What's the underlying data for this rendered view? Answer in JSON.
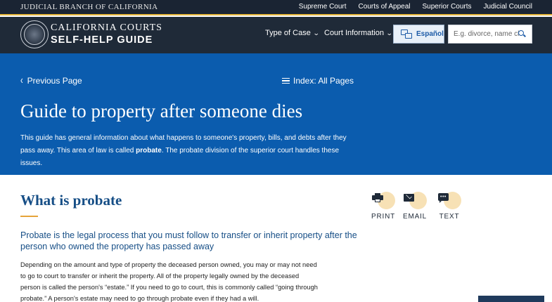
{
  "topbar": {
    "brand": "JUDICIAL BRANCH OF CALIFORNIA",
    "links": [
      "Supreme Court",
      "Courts of Appeal",
      "Superior Courts",
      "Judicial Council"
    ]
  },
  "header": {
    "logo_line1": "CALIFORNIA COURTS",
    "logo_line2": "SELF-HELP GUIDE",
    "nav": [
      {
        "label": "Type of Case",
        "icon": "chevron-down-icon"
      },
      {
        "label": "Court Information",
        "icon": "chevron-down-icon"
      }
    ],
    "language_button": "Español",
    "search_placeholder": "E.g. divorce, name change"
  },
  "hero": {
    "previous_page": "Previous Page",
    "index_link": "Index: All Pages",
    "title": "Guide to property after someone dies",
    "intro_before": "This guide has general information about what happens to someone's property, bills, and debts after they pass away. This area of law is called ",
    "intro_bold": "probate",
    "intro_after": ". The probate division of the superior court handles these issues."
  },
  "content": {
    "section_title": "What is probate",
    "lead": "Probate is the legal process that you must follow to transfer or inherit property after the person who owned the property has passed away",
    "body": "Depending on the amount and type of property the deceased person owned, you may or may not need to go to court to transfer or inherit the property. All of the property legally owned by the deceased person is called the person's “estate.” If you need to go to court, this is commonly called “going through probate.” A person's estate may need to go through probate even if they had a will."
  },
  "share": {
    "print": "PRINT",
    "email": "EMAIL",
    "text": "TEXT"
  },
  "colors": {
    "topbar_bg": "#1a2433",
    "accent_gold": "#e5b53a",
    "header_bg": "#1f2a38",
    "hero_bg": "#0b5cae",
    "heading_blue": "#164e86",
    "icon_highlight": "#f7e1b5"
  }
}
